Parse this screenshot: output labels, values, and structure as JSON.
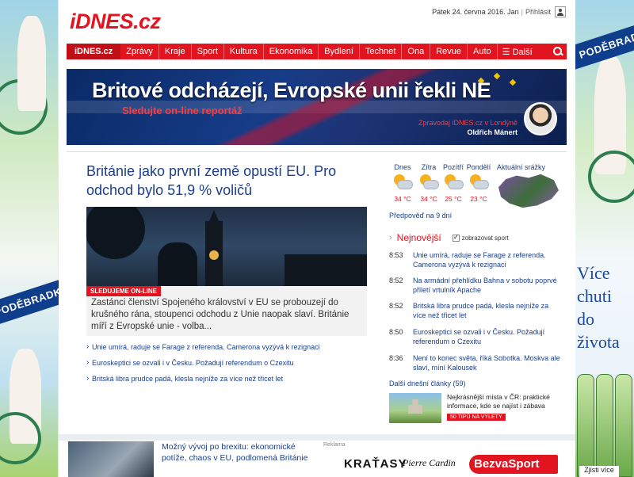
{
  "header": {
    "logo": "iDNES.cz",
    "date": "Pátek 24. června 2016. Jan",
    "login": "Přihlásit"
  },
  "nav": {
    "home": "iDNES.cz",
    "items": [
      "Zprávy",
      "Kraje",
      "Sport",
      "Kultura",
      "Ekonomika",
      "Bydlení",
      "Technet",
      "Ona",
      "Revue",
      "Auto"
    ],
    "more": "☰ Další"
  },
  "banner": {
    "title": "Britové odcházejí, Evropské unii řekli NE",
    "subtitle": "Sledujte on-line reportáž",
    "reporter_role": "Zpravodaj iDNES.cz v Londýně",
    "reporter_name": "Oldřich Mánert"
  },
  "main": {
    "headline": "Británie jako první země opustí EU. Pro odchod bylo 51,9 % voličů",
    "hero_tag": "SLEDUJEME ON-LINE",
    "hero_text": "Zastánci členství Spojeného království v EU se probouzejí do krušného rána, stoupenci odchodu z Unie naopak slaví. Británie míří z Evropské unie - volba...",
    "related": [
      "Unie umírá, raduje se Farage z referenda. Camerona vyzývá k rezignaci",
      "Euroskeptici se ozvali i v Česku. Požadují referendum o Czexitu",
      "Britská libra prudce padá, klesla nejníže za více než třicet let"
    ]
  },
  "weather": {
    "days": [
      {
        "label": "Dnes",
        "temp": "34 °C"
      },
      {
        "label": "Zítra",
        "temp": "34 °C"
      },
      {
        "label": "Pozítří",
        "temp": "25 °C"
      },
      {
        "label": "Pondělí",
        "temp": "23 °C"
      }
    ],
    "rain_label": "Aktuální srážky",
    "forecast_link": "Předpověď na 9 dní"
  },
  "newest": {
    "title": "Nejnovější",
    "checkbox_label": "zobrazovat sport",
    "items": [
      {
        "time": "8:53",
        "text": "Unie umírá, raduje se Farage z referenda. Camerona vyzývá k rezignaci"
      },
      {
        "time": "8:52",
        "text": "Na armádní přehlídku Bahna v sobotu poprvé přiletí vrtulník Apache"
      },
      {
        "time": "8:52",
        "text": "Britská libra prudce padá, klesla nejníže za více než třicet let"
      },
      {
        "time": "8:50",
        "text": "Euroskeptici se ozvali i v Česku. Požadují referendum o Czexitu"
      },
      {
        "time": "8:36",
        "text": "Není to konec světa, říká Sobotka. Moskva ale slaví, míní Kalousek"
      }
    ],
    "more_today": "Další dnešní články (59)",
    "tip_text": "Nejkrásnější místa v ČR: praktické informace, kde se najíst i zábava",
    "tip_button": "50 TIPŮ NA VÝLETY"
  },
  "bottom": {
    "headline": "Možný vývoj po brexitu: ekonomické potíže, chaos v EU, podlomená Británie",
    "reklama": "Reklama",
    "ad1": "KRAŤASY",
    "ad2": "Pierre Cardin",
    "ad3": "BezvaSport"
  },
  "side_ads": {
    "brand": "PODĚBRADKA",
    "slogan": "Více chuti do života",
    "cta": "Zjisti více"
  }
}
